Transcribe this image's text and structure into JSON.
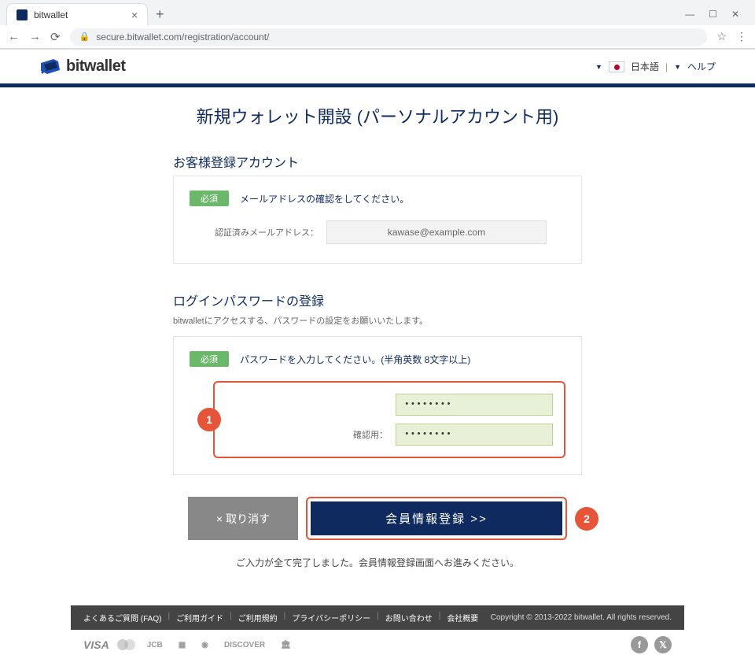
{
  "browser": {
    "tab_title": "bitwallet",
    "url": "secure.bitwallet.com/registration/account/"
  },
  "header": {
    "logo_text": "bitwallet",
    "language": "日本語",
    "help": "ヘルプ"
  },
  "main": {
    "page_title": "新規ウォレット開設 (パーソナルアカウント用)",
    "account_section": {
      "heading": "お客様登録アカウント",
      "required_label": "必須",
      "required_text": "メールアドレスの確認をしてください。",
      "email_label": "認証済みメールアドレス：",
      "email_value": "kawase@example.com"
    },
    "password_section": {
      "heading": "ログインパスワードの登録",
      "subtext": "bitwalletにアクセスする、パスワードの設定をお願いいたします。",
      "required_label": "必須",
      "required_text": "パスワードを入力してください。(半角英数 8文字以上)",
      "password_value": "••••••••",
      "confirm_label": "確認用：",
      "confirm_value": "••••••••",
      "callout_number": "1"
    },
    "actions": {
      "cancel": "取り消す",
      "submit": "会員情報登録 >>",
      "callout_number": "2"
    },
    "completion_text": "ご入力が全て完了しました。会員情報登録画面へお進みください。"
  },
  "footer": {
    "links": [
      "よくあるご質問 (FAQ)",
      "ご利用ガイド",
      "ご利用規約",
      "プライバシーポリシー",
      "お問い合わせ",
      "会社概要"
    ],
    "copyright": "Copyright © 2013-2022 bitwallet. All rights reserved.",
    "payments": [
      "VISA",
      "mastercard",
      "JCB",
      "AMEX",
      "Diners Club",
      "DISCOVER",
      "Bank Transfer"
    ]
  }
}
